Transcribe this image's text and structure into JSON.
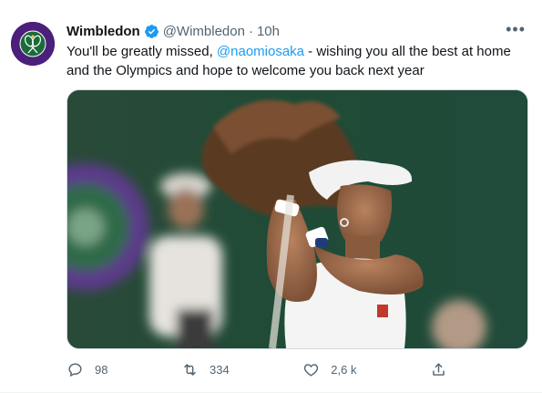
{
  "tweet": {
    "name": "Wimbledon",
    "handle": "@Wimbledon",
    "time_separator": "·",
    "time": "10h",
    "text_prefix": "You'll be greatly missed, ",
    "mention": "@naomiosaka",
    "text_suffix": " - wishing you all the best at home and the Olympics and hope to welcome you back next year",
    "avatar_text_top": "THE CHAMPIONSHIPS",
    "avatar_text_bottom": "WIMBLEDON"
  },
  "actions": {
    "replies": "98",
    "retweets": "334",
    "likes": "2,6 k"
  },
  "icons": {
    "more": "more-icon",
    "verified": "verified-badge-icon",
    "reply": "reply-icon",
    "retweet": "retweet-icon",
    "like": "heart-icon",
    "share": "share-icon"
  },
  "colors": {
    "accent": "#1d9bf0",
    "avatar_bg": "#4b1f7a",
    "secondary_text": "#536471"
  }
}
